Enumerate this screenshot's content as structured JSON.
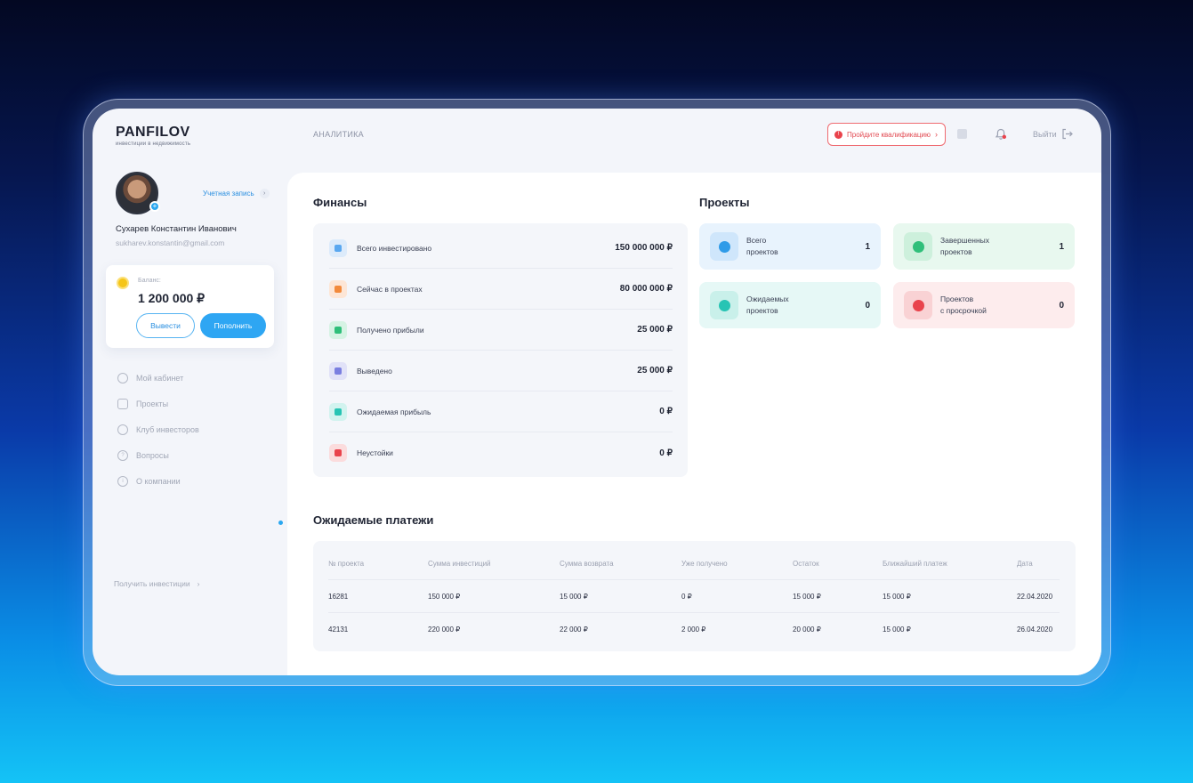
{
  "app": {
    "logo": "PANFILOV",
    "tagline": "инвестиции в недвижимость"
  },
  "header": {
    "nav_analytics": "АНАЛИТИКА",
    "qualification_button": "Пройдите квалификацию",
    "logout_label": "Выйти"
  },
  "profile": {
    "account_link": "Учетная запись",
    "name": "Сухарев Константин Иванович",
    "email": "sukharev.konstantin@gmail.com"
  },
  "balance": {
    "label": "Баланс:",
    "value": "1 200 000 ₽",
    "withdraw_label": "Вывести",
    "topup_label": "Пополнить"
  },
  "menu": [
    {
      "label": "Мой кабинет",
      "icon": "user-icon"
    },
    {
      "label": "Проекты",
      "icon": "document-icon"
    },
    {
      "label": "Клуб инвесторов",
      "icon": "users-icon"
    },
    {
      "label": "Вопросы",
      "icon": "question-icon"
    },
    {
      "label": "О компании",
      "icon": "info-icon"
    }
  ],
  "get_investments": "Получить инвестиции",
  "finance": {
    "title": "Финансы",
    "rows": [
      {
        "label": "Всего инвестировано",
        "value": "150 000 000 ₽",
        "color": "#5aa8f0",
        "bg": "#dcebfb"
      },
      {
        "label": "Сейчас в проектах",
        "value": "80 000 000 ₽",
        "color": "#f28a3c",
        "bg": "#fde6d6"
      },
      {
        "label": "Получено прибыли",
        "value": "25 000 ₽",
        "color": "#2fbf7a",
        "bg": "#d6f3e4"
      },
      {
        "label": "Выведено",
        "value": "25 000 ₽",
        "color": "#7a7fe0",
        "bg": "#e1e2f8"
      },
      {
        "label": "Ожидаемая прибыль",
        "value": "0 ₽",
        "color": "#27c4b4",
        "bg": "#d2f3ef"
      },
      {
        "label": "Неустойки",
        "value": "0 ₽",
        "color": "#e9434c",
        "bg": "#fbdcdd"
      }
    ]
  },
  "projects": {
    "title": "Проекты",
    "cards": [
      {
        "label": "Всего\nпроектов",
        "count": "1",
        "color": "#2f9be8",
        "bg": "#e8f3fd",
        "icon_bg": "#cfe6fb"
      },
      {
        "label": "Завершенных\nпроектов",
        "count": "1",
        "color": "#2fbf7a",
        "bg": "#e8f8ef",
        "icon_bg": "#cdf0dc"
      },
      {
        "label": "Ожидаемых\nпроектов",
        "count": "0",
        "color": "#27c4b4",
        "bg": "#e6f8f6",
        "icon_bg": "#c9f0ea"
      },
      {
        "label": "Проектов\nс просрочкой",
        "count": "0",
        "color": "#e9434c",
        "bg": "#fdeced",
        "icon_bg": "#f9d2d4"
      }
    ]
  },
  "payments": {
    "title": "Ожидаемые платежи",
    "columns": [
      "№ проекта",
      "Сумма инвестиций",
      "Сумма возврата",
      "Уже получено",
      "Остаток",
      "Ближайший платеж",
      "Дата"
    ],
    "rows": [
      [
        "16281",
        "150 000 ₽",
        "15 000 ₽",
        "0 ₽",
        "15 000 ₽",
        "15 000 ₽",
        "22.04.2020"
      ],
      [
        "42131",
        "220 000 ₽",
        "22 000 ₽",
        "2 000 ₽",
        "20 000 ₽",
        "15 000 ₽",
        "26.04.2020"
      ]
    ]
  }
}
